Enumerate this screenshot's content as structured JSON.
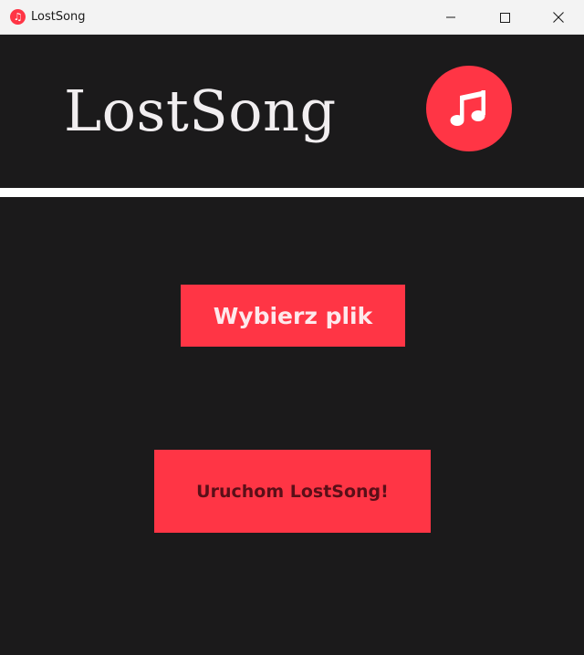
{
  "window": {
    "title": "LostSong",
    "app_icon": "music-note-icon",
    "controls": [
      "minimize-icon",
      "maximize-icon",
      "close-icon"
    ]
  },
  "header": {
    "title": "LostSong",
    "logo_icon": "music-note-icon"
  },
  "main": {
    "choose_file_label": "Wybierz plik",
    "run_label": "Uruchom LostSong!"
  },
  "colors": {
    "background": "#1b1a1b",
    "accent": "#ff3545",
    "divider": "#ffffff",
    "title_text": "#f1eef0"
  }
}
